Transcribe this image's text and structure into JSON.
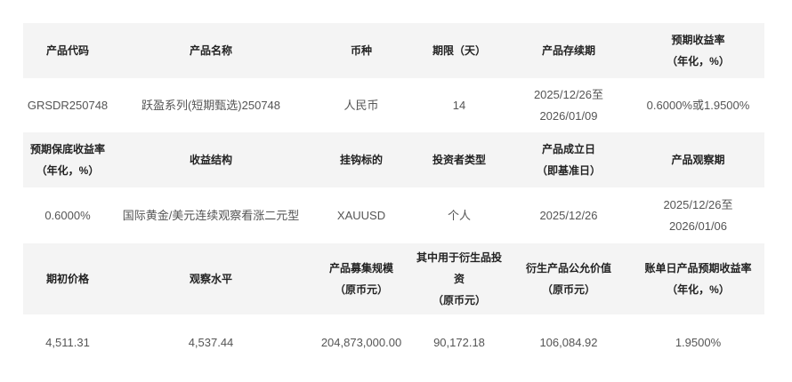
{
  "rows": [
    {
      "kind": "header",
      "cells": [
        "产品代码",
        "产品名称",
        "币种",
        "期限（天）",
        "产品存续期",
        "预期收益率\n（年化，%）"
      ]
    },
    {
      "kind": "value",
      "cells": [
        "GRSDR250748",
        "跃盈系列(短期甄选)250748",
        "人民币",
        "14",
        "2025/12/26至\n2026/01/09",
        "0.6000%或1.9500%"
      ]
    },
    {
      "kind": "header",
      "cells": [
        "预期保底收益率\n（年化，%）",
        "收益结构",
        "挂钩标的",
        "投资者类型",
        "产品成立日\n（即基准日）",
        "产品观察期"
      ]
    },
    {
      "kind": "value",
      "cells": [
        "0.6000%",
        "国际黄金/美元连续观察看涨二元型",
        "XAUUSD",
        "个人",
        "2025/12/26",
        "2025/12/26至\n2026/01/06"
      ]
    },
    {
      "kind": "header",
      "cells": [
        "期初价格",
        "观察水平",
        "产品募集规模\n（原币元）",
        "其中用于衍生品投资\n（原币元）",
        "衍生产品公允价值\n（原币元）",
        "账单日产品预期收益率\n（年化，%）"
      ]
    },
    {
      "kind": "value",
      "cells": [
        "4,511.31",
        "4,537.44",
        "204,873,000.00",
        "90,172.18",
        "106,084.92",
        "1.9500%"
      ]
    }
  ]
}
